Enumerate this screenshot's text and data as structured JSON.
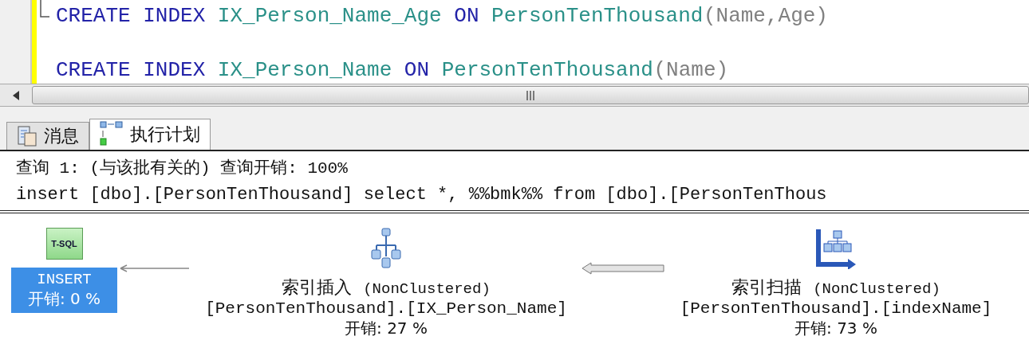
{
  "editor": {
    "lines": [
      {
        "tokens": [
          {
            "kind": "keyword",
            "text": "CREATE"
          },
          {
            "kind": "keyword",
            "text": "INDEX"
          },
          {
            "kind": "identifier",
            "text": "IX_Person_Name_Age"
          },
          {
            "kind": "keyword",
            "text": "ON"
          },
          {
            "kind": "identifier",
            "text": "PersonTenThousand"
          },
          {
            "kind": "punct",
            "text": "(Name,Age)"
          }
        ]
      },
      {
        "tokens": [
          {
            "kind": "keyword",
            "text": "CREATE"
          },
          {
            "kind": "keyword",
            "text": "INDEX"
          },
          {
            "kind": "identifier",
            "text": "IX_Person_Name"
          },
          {
            "kind": "keyword",
            "text": "ON"
          },
          {
            "kind": "identifier",
            "text": "PersonTenThousand"
          },
          {
            "kind": "punct",
            "text": "(Name)"
          }
        ]
      }
    ]
  },
  "tabs": [
    {
      "label": "消息",
      "kind": "messages",
      "selected": false
    },
    {
      "label": "执行计划",
      "kind": "plan",
      "selected": true
    }
  ],
  "plan": {
    "header": [
      "查询 1: (与该批有关的) 查询开销: 100%",
      "insert [dbo].[PersonTenThousand] select *, %%bmk%% from [dbo].[PersonTenThous"
    ],
    "flow": [
      {
        "kind": "statement",
        "icon_text": "T-SQL",
        "label": "INSERT",
        "cost": "开销: 0 %",
        "selected": true
      },
      {
        "kind": "arrow"
      },
      {
        "kind": "operator",
        "title": "索引插入",
        "subtitle": "(NonClustered)",
        "object": "[PersonTenThousand].[IX_Person_Name]",
        "cost": "开销: 27 %",
        "selected": false
      },
      {
        "kind": "arrow"
      },
      {
        "kind": "operator",
        "title": "索引扫描",
        "subtitle": "(NonClustered)",
        "object": "[PersonTenThousand].[indexName]",
        "cost": "开销: 73 %",
        "selected": false
      }
    ]
  }
}
